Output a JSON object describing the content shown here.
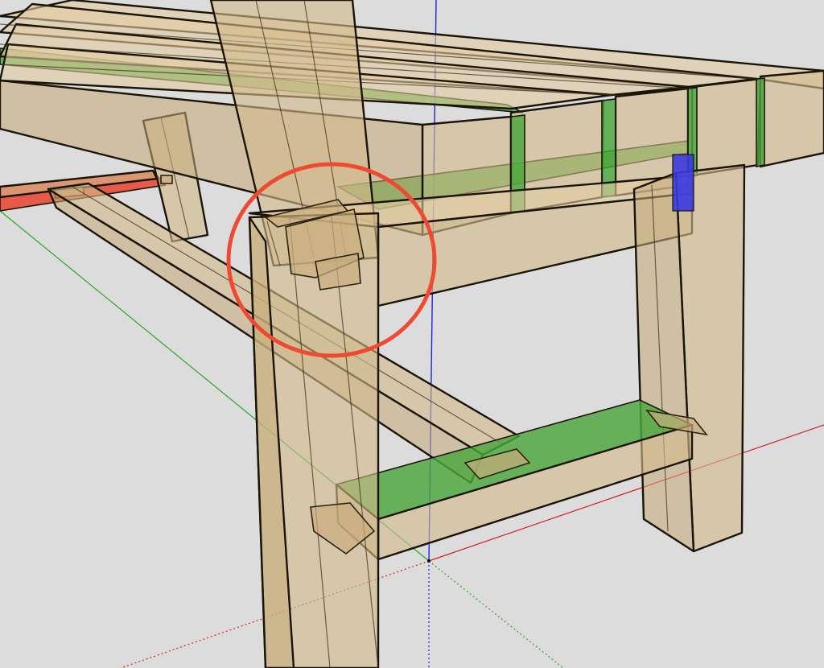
{
  "colors": {
    "background": "#dcdcdc",
    "wood": "#d2b98a",
    "green_face": "#4aa63a",
    "red_face": "#e8432e",
    "blue_face": "#3a3ae0",
    "axis_red": "#d42020",
    "axis_green": "#22aa22",
    "axis_blue": "#2222dd",
    "highlight_circle": "#ee4a32",
    "edge": "#1a1408"
  },
  "icons": {
    "highlight": "highlight-circle-icon",
    "axis_origin": "axis-origin-icon"
  }
}
